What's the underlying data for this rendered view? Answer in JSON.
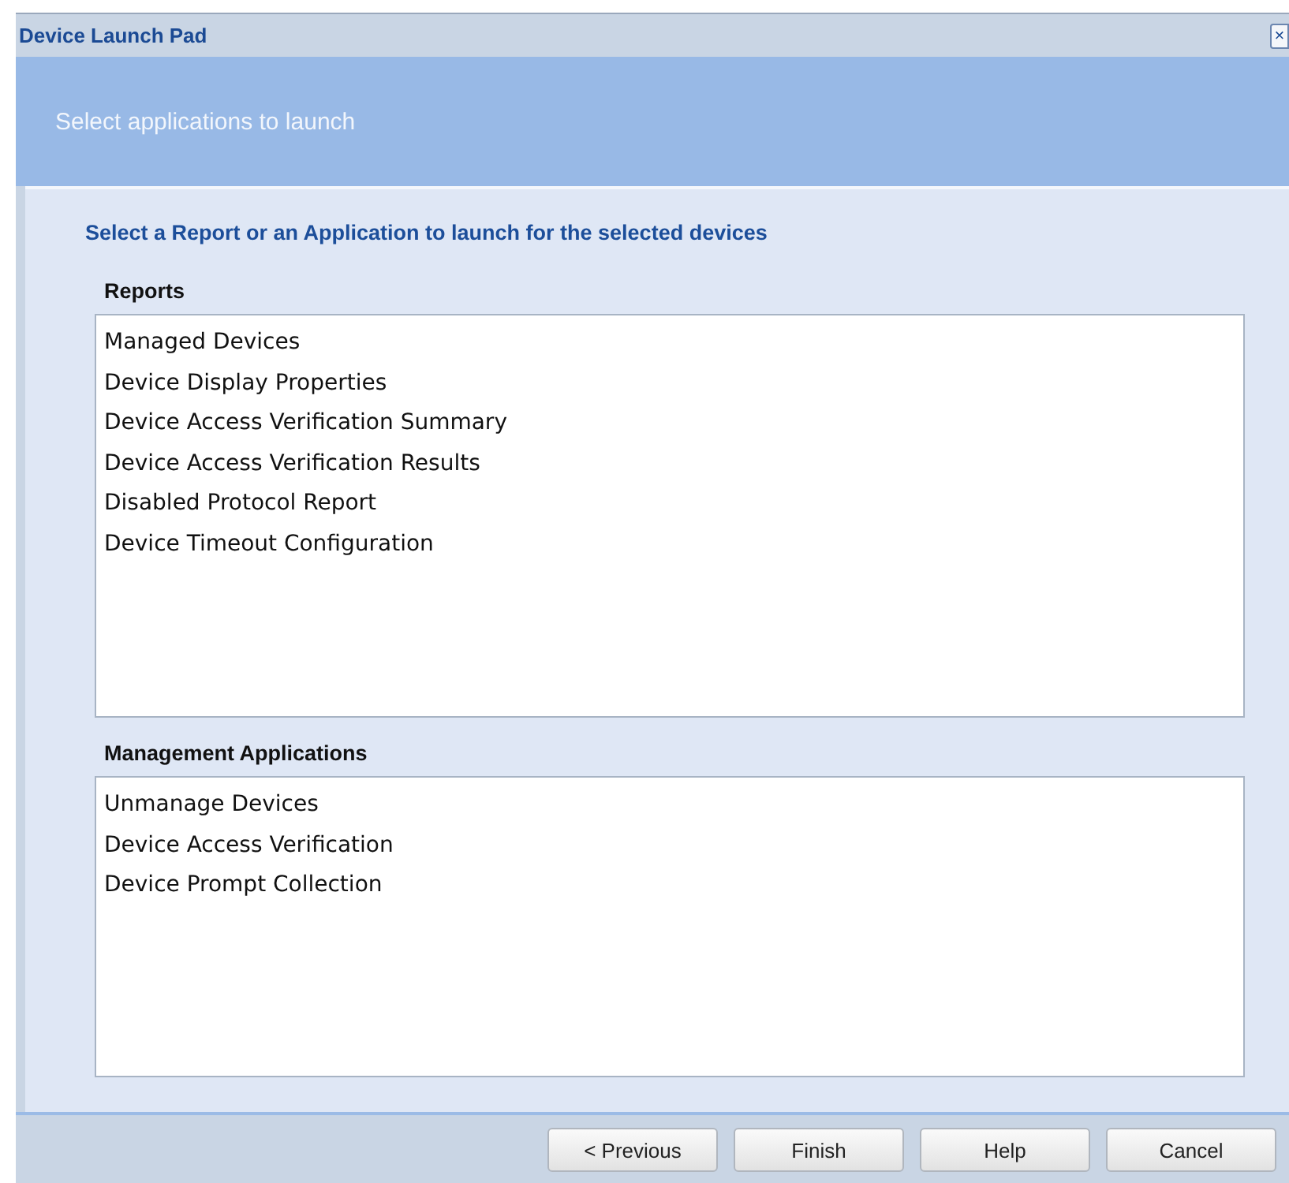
{
  "window": {
    "title": "Device Launch Pad",
    "close": "×"
  },
  "header": {
    "title": "Select applications to launch"
  },
  "instruction": "Select a Report or an Application to launch for the selected devices",
  "reports": {
    "label": "Reports",
    "items": [
      {
        "label": "Managed Devices"
      },
      {
        "label": "Device Display Properties"
      },
      {
        "label": "Device Access Verification Summary"
      },
      {
        "label": "Device Access Verification Results"
      },
      {
        "label": "Disabled Protocol Report"
      },
      {
        "label": "Device Timeout Configuration"
      }
    ]
  },
  "applications": {
    "label": "Management Applications",
    "items": [
      {
        "label": "Unmanage Devices"
      },
      {
        "label": "Device Access Verification"
      },
      {
        "label": "Device Prompt Collection"
      }
    ]
  },
  "buttons": [
    "< Previous",
    "Finish",
    "Help",
    "Cancel"
  ]
}
